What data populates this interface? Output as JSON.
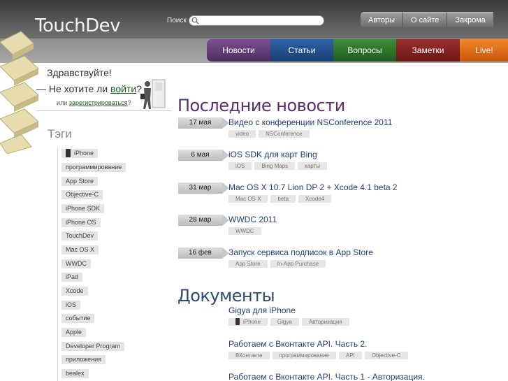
{
  "header": {
    "logo": "TouchDev",
    "search_label": "Поиск",
    "top_links": [
      "Авторы",
      "О сайте",
      "Закрома"
    ],
    "nav_tabs": [
      "Новости",
      "Статьи",
      "Вопросы",
      "Заметки",
      "Live!"
    ]
  },
  "greeting": {
    "hello": "Здравствуйте!",
    "prefix": "— Не хотите ли ",
    "login_link": "войти",
    "suffix": "?",
    "register_prefix": "или ",
    "register_link": "зарегистрироваться",
    "register_suffix": "?"
  },
  "tags": {
    "title": "Тэги",
    "items": [
      "iPhone",
      "программирование",
      "App Store",
      "Objective-C",
      "iPhone SDK",
      "iPhone OS",
      "TouchDev",
      "Mac OS X",
      "WWDC",
      "iPad",
      "Xcode",
      "iOS",
      "событие",
      "Apple",
      "Developer Program",
      "приложения",
      "bealex"
    ]
  },
  "news": {
    "heading": "Последние новости",
    "items": [
      {
        "date": "17 мая",
        "title": "Видео с конференции NSConference 2011",
        "tags": [
          "video",
          "NSConference"
        ]
      },
      {
        "date": "6 мая",
        "title": "iOS SDK для карт Bing",
        "tags": [
          "iOS",
          "Bing Maps",
          "карты"
        ]
      },
      {
        "date": "31 мар",
        "title": "Mac OS X 10.7 Lion DP 2 + Xcode 4.1 beta 2",
        "tags": [
          "Mac OS X",
          "beta",
          "Xcode4"
        ]
      },
      {
        "date": "28 мар",
        "title": "WWDC 2011",
        "tags": [
          "WWDC"
        ]
      },
      {
        "date": "16 фев",
        "title": "Запуск сервиса подписок в App Store",
        "tags": [
          "App Store",
          "In-App Purchase"
        ]
      }
    ]
  },
  "documents": {
    "heading": "Документы",
    "items": [
      {
        "title": "Gigya для iPhone",
        "tags": [
          "iPhone",
          "Gigya",
          "Авторизация"
        ]
      },
      {
        "title": "Работаем с Вконтакте API. Часть 2.",
        "tags": [
          "ВКонтакте",
          "программирование",
          "API",
          "Objective-C"
        ]
      },
      {
        "title": "Работаем с Вконтакте API. Часть 1 - Авторизация.",
        "tags": []
      }
    ]
  },
  "colors": {
    "news_tab": "#5e3a73",
    "articles_tab": "#24508c",
    "questions_tab": "#2e7429",
    "notes_tab": "#832222",
    "live_tab": "#e0701a"
  }
}
